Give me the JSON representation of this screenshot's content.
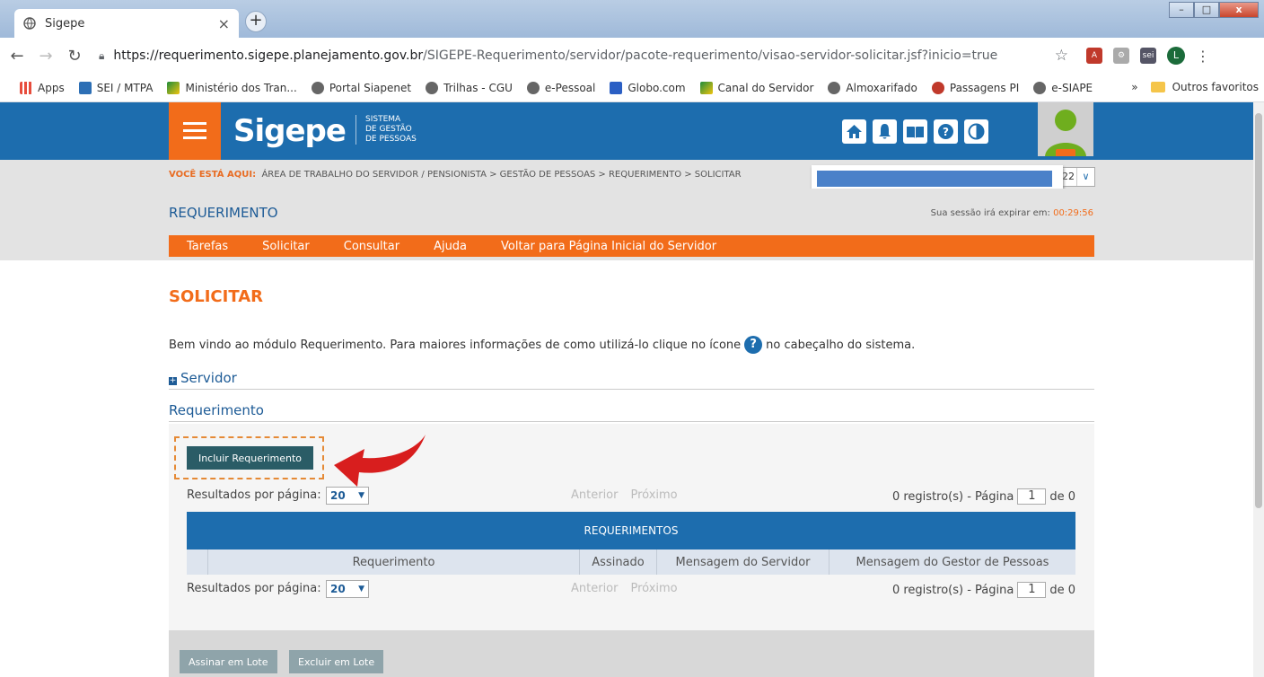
{
  "browser": {
    "tab_title": "Sigepe",
    "tab_close": "×",
    "new_tab": "+",
    "url_host": "https://requerimento.sigepe.planejamento.gov.br",
    "url_path": "/SIGEPE-Requerimento/servidor/pacote-requerimento/visao-servidor-solicitar.jsf?inicio=true",
    "bookmarks": [
      "Apps",
      "SEI / MTPA",
      "Ministério dos Tran...",
      "Portal Siapenet",
      "Trilhas - CGU",
      "e-Pessoal",
      "Globo.com",
      "Canal do Servidor",
      "Almoxarifado",
      "Passagens PI",
      "e-SIAPE"
    ],
    "bookmarks_more": "»",
    "other_bookmarks": "Outros favoritos",
    "profile_initial": "L"
  },
  "header": {
    "logo": "Sigepe",
    "logo_sub": [
      "SISTEMA",
      "DE GESTÃO",
      "DE PESSOAS"
    ]
  },
  "breadcrumb": {
    "prefix": "VOCÊ ESTÁ AQUI:",
    "path": "ÁREA DE TRABALHO DO SERVIDOR / PENSIONISTA  >  GESTÃO DE PESSOAS  >  REQUERIMENTO  >  SOLICITAR",
    "select_value": "22"
  },
  "subheader": {
    "title": "REQUERIMENTO",
    "session_label": "Sua sessão irá expirar em:",
    "session_time": "00:29:56"
  },
  "menu": [
    "Tarefas",
    "Solicitar",
    "Consultar",
    "Ajuda",
    "Voltar para Página Inicial do Servidor"
  ],
  "content": {
    "heading": "SOLICITAR",
    "intro_before": "Bem vindo ao módulo Requerimento. Para maiores informações de como utilizá-lo clique no ícone",
    "intro_after": "no cabeçalho do sistema.",
    "section_servidor": "Servidor",
    "section_requerimento": "Requerimento",
    "include_button": "Incluir Requerimento"
  },
  "pager": {
    "label": "Resultados por página:",
    "per_page": "20",
    "prev": "Anterior",
    "next": "Próximo",
    "count": "0 registro(s) - Página",
    "page": "1",
    "of": "de 0"
  },
  "table": {
    "caption": "REQUERIMENTOS",
    "columns": [
      "Requerimento",
      "Assinado",
      "Mensagem do Servidor",
      "Mensagem do Gestor de Pessoas"
    ]
  },
  "actions": {
    "sign_batch": "Assinar em Lote",
    "delete_batch": "Excluir em Lote"
  }
}
